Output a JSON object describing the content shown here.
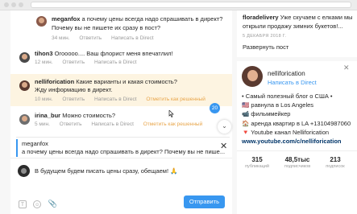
{
  "comments": [
    {
      "author": "meganfox",
      "text_line1": "а почему цены всегда надо спрашивать в директ?",
      "text_line2": "Почему вы не пишете их сразу в пост?",
      "time": "34 мин.",
      "reply": "Ответить",
      "direct": "Написать в Direct"
    },
    {
      "author": "tihon3",
      "text_line1": "Огооооо.... Ваш флорист меня впечатлил!",
      "time": "12 мин.",
      "reply": "Ответить",
      "direct": "Написать в Direct"
    },
    {
      "author": "nelliforication",
      "text_line1": "Какие варианты и какая стоимость?",
      "text_line2": "Жду информацию в директ.",
      "time": "10 мин.",
      "reply": "Ответить",
      "direct": "Написать в Direct",
      "resolve": "Отметить как решенный"
    },
    {
      "author": "irina_bur",
      "text_line1": "Можно стоимость?",
      "time": "5 мин.",
      "reply": "Ответить",
      "direct": "Написать в Direct",
      "resolve": "Отметить как решенный"
    }
  ],
  "new_badge": "20",
  "reply_to": {
    "author": "meganfox",
    "text": "а почему цены всегда надо спрашивать в директ? Почему вы не пише..."
  },
  "compose": {
    "draft": "В будущем будем писать цены сразу, обещаем! 🙏",
    "send": "Отправить"
  },
  "side_post": {
    "author": "floradelivery",
    "text_line1": "Уже скучаем с елками мы",
    "text_line2": "открыли продажу зимних букетов!...",
    "date": "5 ДЕКАБРЯ 2018 Г.",
    "expand": "Развернуть пост"
  },
  "profile": {
    "username": "nelliforication",
    "direct_link": "Написать в Direct",
    "bio": [
      "• Самый полезный блог о США •",
      "🇺🇸 равнула в Los Angeles",
      "📹 фильммейкер",
      "🏠 аренда квартир в LA +13104987060",
      "🔻 Youtube канал Nelliforication"
    ],
    "link": "www.youtube.com/c/nelliforication",
    "stats": [
      {
        "value": "315",
        "label": "публикаций"
      },
      {
        "value": "48,5тыс",
        "label": "подписчиков"
      },
      {
        "value": "213",
        "label": "подписок"
      }
    ]
  },
  "colors": {
    "accent": "#3897f0",
    "resolve": "#e8a54a",
    "highlight": "#fdf4e1"
  }
}
